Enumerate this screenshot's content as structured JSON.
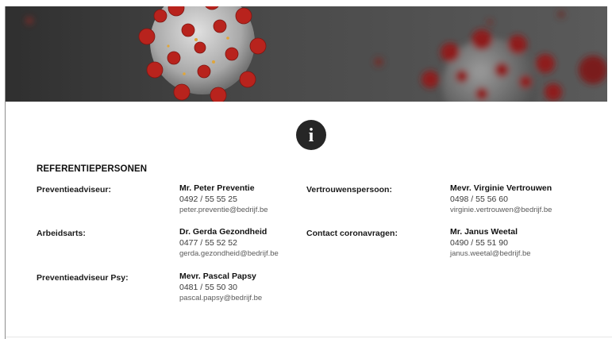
{
  "heading": "REFERENTIEPERSONEN",
  "colors": {
    "virus_red": "#b8231d",
    "virus_spike": "#c22a22",
    "virus_body": "#bdbdbd",
    "banner_bg": "#3a3a3a",
    "badge": "#262626"
  },
  "icons": {
    "info": "info-icon"
  },
  "info_glyph": "i",
  "roles": [
    {
      "label": "Preventieadviseur:",
      "name": "Mr. Peter Preventie",
      "phone": "0492 / 55 55 25",
      "email": "peter.preventie@bedrijf.be"
    },
    {
      "label": "Vertrouwenspersoon:",
      "name": "Mevr. Virginie Vertrouwen",
      "phone": "0498 / 55 56 60",
      "email": "virginie.vertrouwen@bedrijf.be"
    },
    {
      "label": "Arbeidsarts:",
      "name": "Dr. Gerda Gezondheid",
      "phone": "0477 / 55 52 52",
      "email": "gerda.gezondheid@bedrijf.be"
    },
    {
      "label": "Contact coronavragen:",
      "name": "Mr. Janus Weetal",
      "phone": "0490 / 55 51 90",
      "email": "janus.weetal@bedrijf.be"
    },
    {
      "label": "Preventieadviseur Psy:",
      "name": "Mevr. Pascal Papsy",
      "phone": "0481 / 55 50 30",
      "email": "pascal.papsy@bedrijf.be"
    }
  ]
}
